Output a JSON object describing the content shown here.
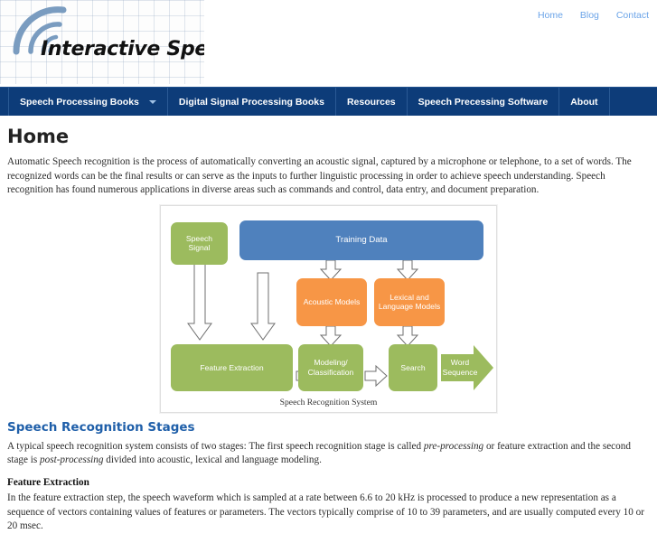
{
  "header": {
    "logo_text": "Interactive Speech",
    "logo_icon": "sound-wave-arcs-icon",
    "top_links": [
      {
        "label": "Home"
      },
      {
        "label": "Blog"
      },
      {
        "label": "Contact"
      }
    ]
  },
  "nav": {
    "items": [
      {
        "label": "Speech Processing Books",
        "has_dropdown": true,
        "icon": "chevron-down-icon"
      },
      {
        "label": "Digital Signal Processing Books",
        "has_dropdown": false
      },
      {
        "label": "Resources",
        "has_dropdown": false
      },
      {
        "label": "Speech Precessing Software",
        "has_dropdown": false
      },
      {
        "label": "About",
        "has_dropdown": false
      }
    ]
  },
  "main": {
    "page_title": "Home",
    "intro_paragraph": "Automatic Speech recognition is the process of automatically converting an acoustic signal, captured by a microphone or telephone, to a set of words. The recognized words can be the final results or can serve as the inputs to further linguistic processing in order to achieve speech understanding. Speech recognition has found numerous applications in diverse areas such as commands and control, data entry, and document preparation.",
    "section_title": "Speech Recognition Stages",
    "section_paragraph_1": "A typical speech recognition system consists of two stages: The first speech recognition stage is called ",
    "section_paragraph_1_em1": "pre-processing",
    "section_paragraph_1_mid": " or feature extraction and the second stage is ",
    "section_paragraph_1_em2": "post-processing",
    "section_paragraph_1_end": " divided into acoustic, lexical and language modeling.",
    "subsection_title": "Feature Extraction",
    "subsection_paragraph": "In the feature extraction step, the speech waveform which is sampled at a rate between 6.6 to 20 kHz is processed to produce a new representation as a sequence of vectors containing values of features or parameters. The vectors typically comprise of 10 to 39 parameters, and are usually computed every 10 or 20 msec."
  },
  "diagram": {
    "caption": "Speech Recognition System",
    "nodes": [
      {
        "id": "speech-signal",
        "label": "Speech\nSignal",
        "color": "#9cbb5e",
        "shape": "rounded-rect"
      },
      {
        "id": "training-data",
        "label": "Training Data",
        "color": "#4f81bd",
        "shape": "rounded-rect"
      },
      {
        "id": "acoustic-models",
        "label": "Acoustic Models",
        "color": "#f79646",
        "shape": "rounded-rect"
      },
      {
        "id": "lexical-language",
        "label": "Lexical and\nLanguage Models",
        "color": "#f79646",
        "shape": "rounded-rect"
      },
      {
        "id": "feature-extraction",
        "label": "Feature Extraction",
        "color": "#9cbb5e",
        "shape": "rounded-rect"
      },
      {
        "id": "modeling-classification",
        "label": "Modeling/\nClassification",
        "color": "#9cbb5e",
        "shape": "rounded-rect"
      },
      {
        "id": "search",
        "label": "Search",
        "color": "#9cbb5e",
        "shape": "rounded-rect"
      },
      {
        "id": "word-sequence",
        "label": "Word\nSequence",
        "color": "#9cbb5e",
        "shape": "block-arrow"
      }
    ],
    "node_labels": {
      "speech_signal_l1": "Speech",
      "speech_signal_l2": "Signal",
      "training_data": "Training Data",
      "acoustic_models": "Acoustic Models",
      "lexical_l1": "Lexical and",
      "lexical_l2": "Language Models",
      "feature_extraction": "Feature Extraction",
      "modeling_l1": "Modeling/",
      "modeling_l2": "Classification",
      "search": "Search",
      "word_l1": "Word",
      "word_l2": "Sequence"
    }
  },
  "colors": {
    "nav_bg": "#0d3c79",
    "link_blue": "#6ba4e8",
    "heading_blue": "#1f5fa9",
    "diagram_green": "#9cbb5e",
    "diagram_blue": "#4f81bd",
    "diagram_orange": "#f79646"
  }
}
